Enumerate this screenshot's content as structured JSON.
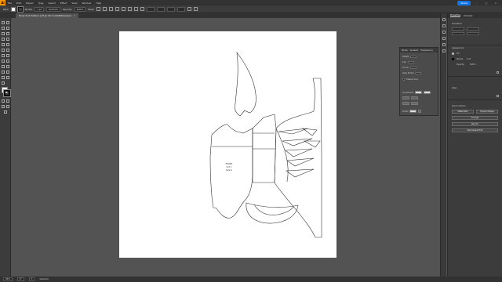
{
  "app": {
    "logo": "Ai"
  },
  "menu": [
    "File",
    "Edit",
    "Object",
    "Type",
    "Select",
    "Effect",
    "View",
    "Window",
    "Help"
  ],
  "topright": {
    "share_label": "Share"
  },
  "controlbar": {
    "selection_label": "Path",
    "stroke_label": "Stroke",
    "stroke_value": "1 pt",
    "stroke_profile": "Uniform",
    "opacity_label": "Opacity",
    "opacity_value": "100%",
    "style_label": "Style",
    "x_value": "",
    "y_value": "",
    "w_value": "",
    "h_value": ""
  },
  "document": {
    "tab_title": "Body Suit Pattern.pdf @ 49 % (RGB/Preview)",
    "pattern_text_1": "FRONT",
    "pattern_text_2": "Cut 1",
    "pattern_text_3": "Size S"
  },
  "floating_panel": {
    "tabs": [
      "Stroke",
      "Gradient",
      "Transparency"
    ],
    "weight_label": "Weight",
    "cap_label": "Cap",
    "corner_label": "Corner",
    "align_label": "Align Stroke",
    "dashed_label": "Dashed Line",
    "arrow_label": "Arrowheads",
    "profile_label": "Profile"
  },
  "properties": {
    "tabs": [
      "Properties",
      "Libraries"
    ],
    "transform_label": "Transform",
    "appearance_label": "Appearance",
    "fill_label": "Fill",
    "stroke_label": "Stroke",
    "stroke_value": "1 pt",
    "opacity_label": "Opacity",
    "opacity_value": "100%",
    "align_label": "Align",
    "quick_actions_label": "Quick Actions",
    "buttons": [
      "Offset Path",
      "Expand Shape",
      "Arrange",
      "Recolor",
      "Start Global Edit"
    ]
  },
  "status": {
    "zoom": "49%",
    "angle": "0°",
    "page": "1",
    "tool": "Selection"
  }
}
